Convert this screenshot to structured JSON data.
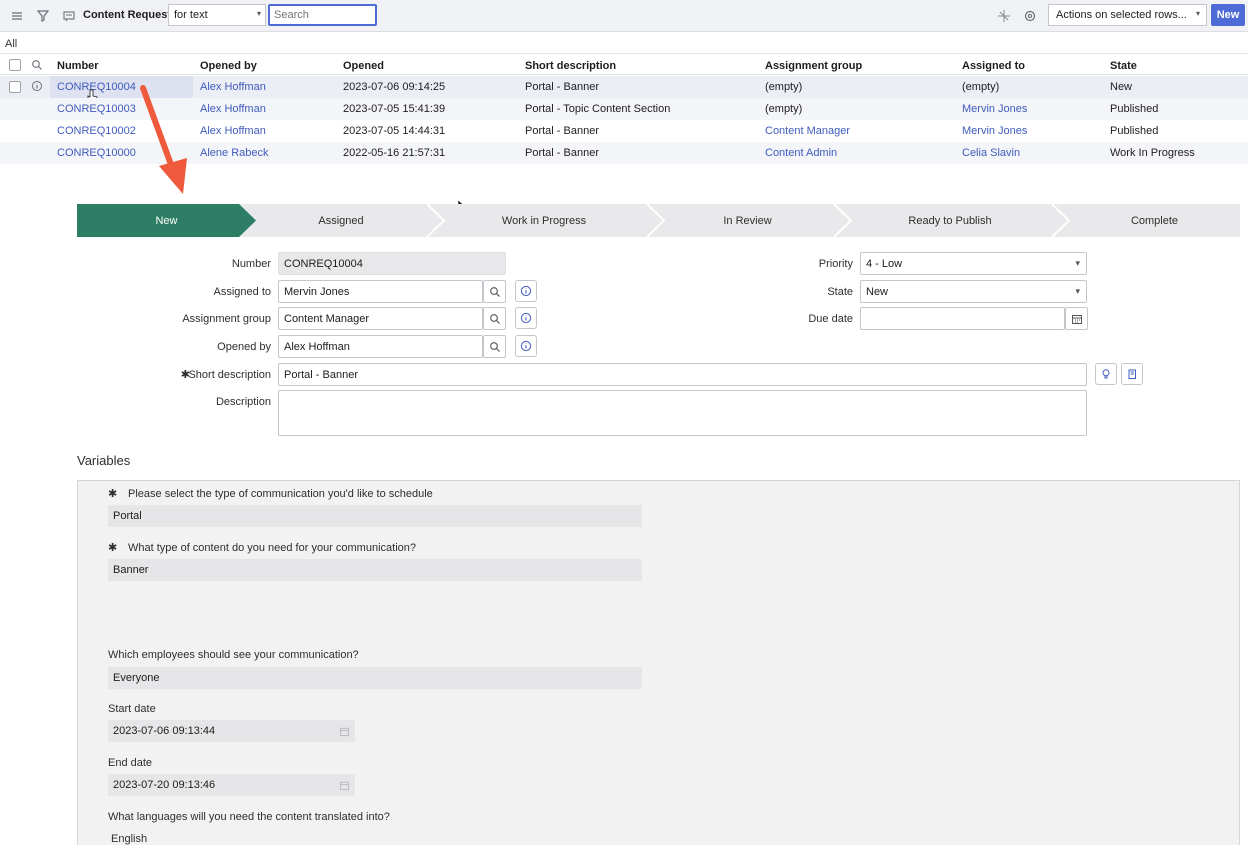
{
  "toolbar": {
    "title": "Content Requests",
    "filter_select": "for text",
    "search_placeholder": "Search",
    "actions_select": "Actions on selected rows...",
    "new_button": "New"
  },
  "breadcrumb": "All",
  "list": {
    "columns": [
      "Number",
      "Opened by",
      "Opened",
      "Short description",
      "Assignment group",
      "Assigned to",
      "State"
    ],
    "rows": [
      {
        "number": "CONREQ10004",
        "opened_by": "Alex Hoffman",
        "opened": "2023-07-06 09:14:25",
        "short_description": "Portal - Banner",
        "assignment_group": "(empty)",
        "assigned_to": "(empty)",
        "state": "New"
      },
      {
        "number": "CONREQ10003",
        "opened_by": "Alex Hoffman",
        "opened": "2023-07-05 15:41:39",
        "short_description": "Portal - Topic Content Section",
        "assignment_group": "(empty)",
        "assigned_to": "Mervin Jones",
        "state": "Published"
      },
      {
        "number": "CONREQ10002",
        "opened_by": "Alex Hoffman",
        "opened": "2023-07-05 14:44:31",
        "short_description": "Portal - Banner",
        "assignment_group": "Content Manager",
        "assigned_to": "Mervin Jones",
        "state": "Published"
      },
      {
        "number": "CONREQ10000",
        "opened_by": "Alene Rabeck",
        "opened": "2022-05-16 21:57:31",
        "short_description": "Portal - Banner",
        "assignment_group": "Content Admin",
        "assigned_to": "Celia Slavin",
        "state": "Work In Progress"
      }
    ]
  },
  "flow": {
    "steps": [
      "New",
      "Assigned",
      "Work in Progress",
      "In Review",
      "Ready to Publish",
      "Complete"
    ],
    "active_color": "#2e7d65"
  },
  "form": {
    "number_label": "Number",
    "number_value": "CONREQ10004",
    "assigned_to_label": "Assigned to",
    "assigned_to_value": "Mervin Jones",
    "assignment_group_label": "Assignment group",
    "assignment_group_value": "Content Manager",
    "opened_by_label": "Opened by",
    "opened_by_value": "Alex Hoffman",
    "short_description_label": "Short description",
    "short_description_value": "Portal - Banner",
    "description_label": "Description",
    "description_value": "",
    "priority_label": "Priority",
    "priority_value": "4 - Low",
    "state_label": "State",
    "state_value": "New",
    "due_date_label": "Due date",
    "due_date_value": ""
  },
  "variables": {
    "title": "Variables",
    "q1": "Please select the type of communication you'd like to schedule",
    "a1": "Portal",
    "q2": "What type of content do you need for your communication?",
    "a2": "Banner",
    "q3": "Which employees should see your communication?",
    "a3": "Everyone",
    "q4": "Start date",
    "a4": "2023-07-06 09:13:44",
    "q5": "End date",
    "a5": "2023-07-20 09:13:46",
    "q6": "What languages will you need the content translated into?",
    "a6": "English"
  },
  "colors": {
    "accent": "#4f6bd5",
    "link": "#3f5bbd",
    "annotation_arrow": "#ef5a3c"
  }
}
